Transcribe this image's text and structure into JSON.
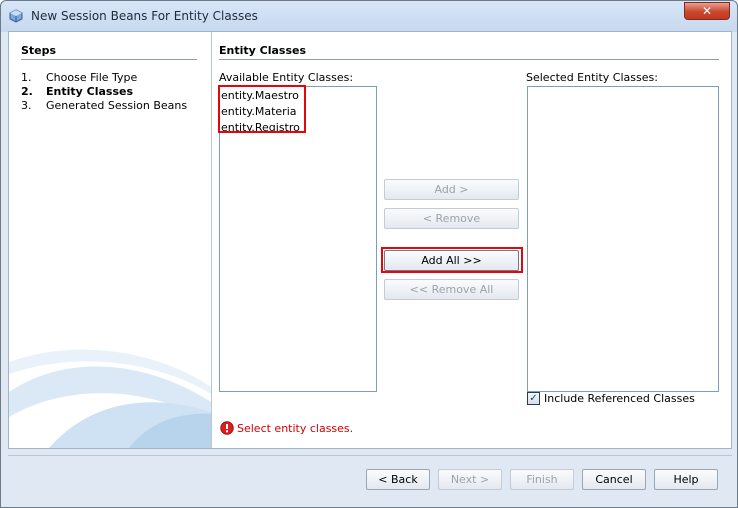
{
  "window": {
    "title": "New Session Beans For Entity Classes"
  },
  "steps": {
    "heading": "Steps",
    "items": [
      {
        "num": "1.",
        "label": "Choose File Type"
      },
      {
        "num": "2.",
        "label": "Entity Classes"
      },
      {
        "num": "3.",
        "label": "Generated Session Beans"
      }
    ]
  },
  "panel": {
    "heading": "Entity Classes",
    "available_label": "Available Entity Classes:",
    "selected_label": "Selected Entity Classes:",
    "available_items": [
      "entity.Maestro",
      "entity.Materia",
      "entity.Registro"
    ],
    "add_label": "Add >",
    "remove_label": "< Remove",
    "add_all_label": "Add All >>",
    "remove_all_label": "<< Remove All",
    "include_label": "Include Referenced Classes",
    "error_message": "Select entity classes."
  },
  "footer": {
    "back_label": "< Back",
    "next_label": "Next >",
    "finish_label": "Finish",
    "cancel_label": "Cancel",
    "help_label": "Help"
  },
  "colors": {
    "highlight": "#e3060c",
    "error": "#d30000"
  },
  "icons": {
    "app": "netbeans-cube-icon",
    "close": "close-icon",
    "error": "error-icon",
    "check": "checkmark-icon"
  }
}
